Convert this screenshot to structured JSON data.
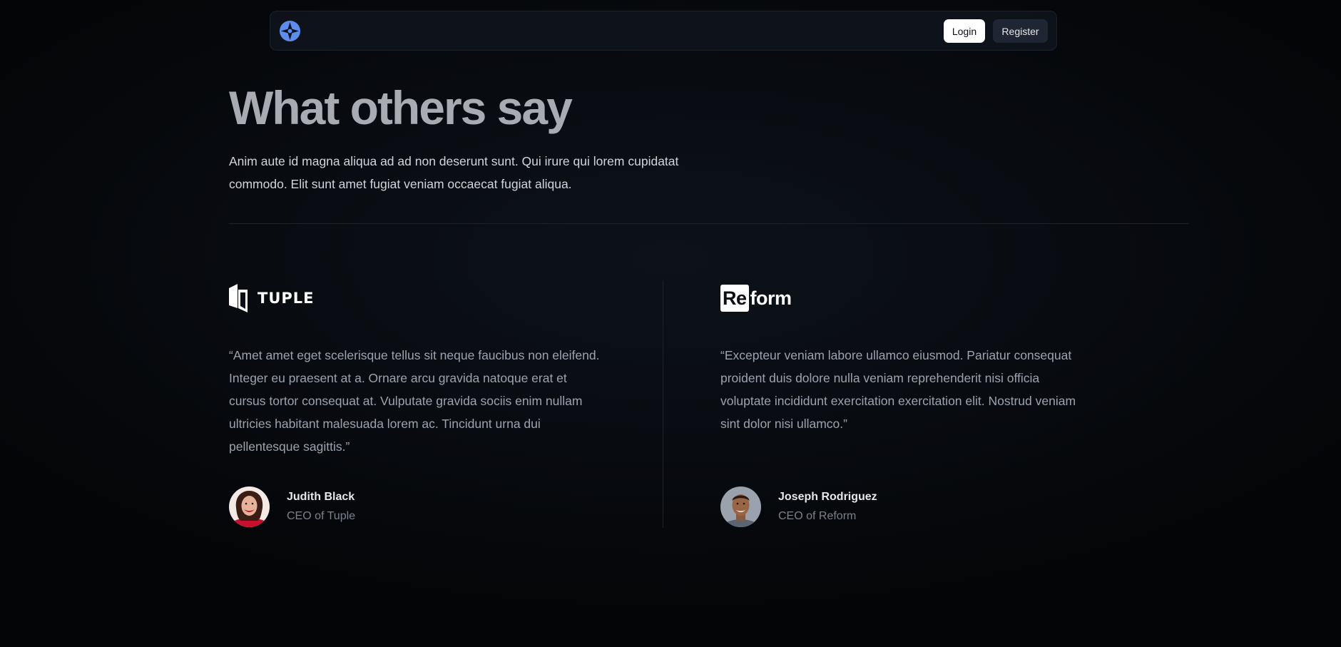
{
  "nav": {
    "logo_icon": "brand-logo-icon",
    "login_label": "Login",
    "register_label": "Register"
  },
  "hero": {
    "title": "What others say",
    "description": "Anim aute id magna aliqua ad ad non deserunt sunt. Qui irure qui lorem cupidatat commodo. Elit sunt amet fugiat veniam occaecat fugiat aliqua."
  },
  "testimonials": [
    {
      "company_logo_icon": "tuple-logo",
      "company_logo_text": "TUPLE",
      "quote": "“Amet amet eget scelerisque tellus sit neque faucibus non eleifend. Integer eu praesent at a. Ornare arcu gravida natoque erat et cursus tortor consequat at. Vulputate gravida sociis enim nullam ultricies habitant malesuada lorem ac. Tincidunt urna dui pellentesque sagittis.”",
      "author_name": "Judith Black",
      "author_role": "CEO of Tuple"
    },
    {
      "company_logo_icon": "reform-logo",
      "company_logo_boxed": "Re",
      "company_logo_rest": "form",
      "quote": "“Excepteur veniam labore ullamco eiusmod. Pariatur consequat proident duis dolore nulla veniam reprehenderit nisi officia voluptate incididunt exercitation exercitation elit. Nostrud veniam sint dolor nisi ullamco.”",
      "author_name": "Joseph Rodriguez",
      "author_role": "CEO of Reform"
    }
  ],
  "colors": {
    "accent": "#5b8def",
    "background": "#080b10",
    "heading": "#a8abb1"
  }
}
